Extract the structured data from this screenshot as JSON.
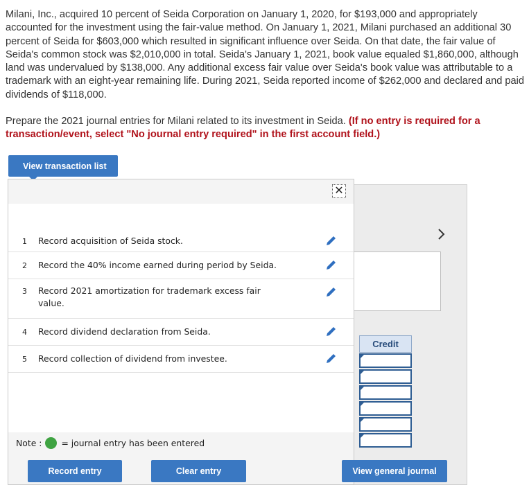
{
  "question": {
    "paragraph1": "Milani, Inc., acquired 10 percent of Seida Corporation on January 1, 2020, for $193,000 and appropriately accounted for the investment using the fair-value method. On January 1, 2021, Milani purchased an additional 30 percent of Seida for $603,000 which resulted in significant influence over Seida. On that date, the fair value of Seida's common stock was $2,010,000 in total. Seida's January 1, 2021, book value equaled $1,860,000, although land was undervalued by $138,000. Any additional excess fair value over Seida's book value was attributable to a trademark with an eight-year remaining life. During 2021, Seida reported income of $262,000 and declared and paid dividends of $118,000.",
    "paragraph2": "Prepare the 2021 journal entries for Milani related to its investment in Seida.",
    "instruction": "(If no entry is required for a transaction/event, select \"No journal entry required\" in the first account field.)"
  },
  "buttons": {
    "view_transaction_list": "View transaction list",
    "record_entry": "Record entry",
    "clear_entry": "Clear entry",
    "view_general_journal": "View general journal"
  },
  "journal": {
    "credit_header": "Credit"
  },
  "transactions": [
    {
      "num": "1",
      "desc": "Record acquisition of Seida stock."
    },
    {
      "num": "2",
      "desc": "Record the 40% income earned during period by Seida."
    },
    {
      "num": "3",
      "desc": "Record 2021 amortization for trademark excess fair value."
    },
    {
      "num": "4",
      "desc": "Record dividend declaration from Seida."
    },
    {
      "num": "5",
      "desc": "Record collection of dividend from investee."
    }
  ],
  "note": {
    "prefix": "Note :",
    "suffix": "= journal entry has been entered"
  },
  "colors": {
    "button": "#3a78c2",
    "warning": "#b0121b",
    "entered_dot": "#3fa342",
    "pencil": "#2f6fc0"
  },
  "icons": {
    "close": "close-icon",
    "edit": "pencil-icon",
    "next": "chevron-right-icon",
    "status": "green-dot-icon"
  }
}
